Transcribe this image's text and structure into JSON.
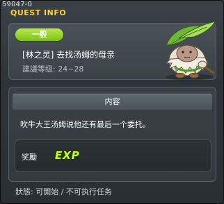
{
  "window": {
    "id_text": "59047-0",
    "title": "QUEST INFO"
  },
  "quest": {
    "category": "一般",
    "name": "[林之灵] 去找汤姆的母亲",
    "level_text": "建議等级: 24~28"
  },
  "content": {
    "header": "内容",
    "description": "吹牛大王汤姆说他还有最后一个委托。"
  },
  "reward": {
    "label": "奖勵",
    "exp_label": "EXP"
  },
  "status": {
    "text": "狀態: 可開始 / 不可执行任务"
  },
  "colors": {
    "title": "#ffd23a",
    "badge": "#9ad633",
    "exp": "#c8ff1a"
  },
  "icons": {
    "portrait": "npc-portrait-icon"
  }
}
